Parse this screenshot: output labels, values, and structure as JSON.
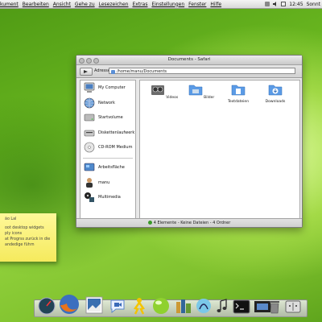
{
  "menubar": {
    "items": [
      "kument",
      "Bearbeiten",
      "Ansicht",
      "Gehe zu",
      "Lesezeichen",
      "Extras",
      "Einstellungen",
      "Fenster",
      "Hilfe"
    ],
    "clock": "12:45",
    "day": "Sonnt"
  },
  "window": {
    "title": "Documents - Safari",
    "address_label": "Adresse:",
    "address_value": "/home/manu/Documents",
    "status": "4 Elemente - Keine Dateien - 4 Ordner"
  },
  "sidebar": {
    "devices": [
      {
        "label": "My Computer",
        "icon": "computer-icon"
      },
      {
        "label": "Network",
        "icon": "network-icon"
      },
      {
        "label": "Startvolume",
        "icon": "hard-drive-icon"
      },
      {
        "label": "Diskettenlaufwerk",
        "icon": "floppy-drive-icon"
      },
      {
        "label": "CD-ROM Medium",
        "icon": "cdrom-icon"
      }
    ],
    "places": [
      {
        "label": "Arbeitsfläche",
        "icon": "desktop-icon"
      },
      {
        "label": "manu",
        "icon": "home-user-icon"
      },
      {
        "label": "Multimedia",
        "icon": "multimedia-icon"
      }
    ]
  },
  "files": [
    {
      "label": "Videos",
      "icon": "video-folder-icon"
    },
    {
      "label": "Bilder",
      "icon": "pictures-folder-icon"
    },
    {
      "label": "Textdateien",
      "icon": "text-folder-icon"
    },
    {
      "label": "Downloads",
      "icon": "downloads-folder-icon"
    }
  ],
  "note": {
    "title": "ão Lal",
    "lines": [
      "oot desktop widgets",
      "ply icons",
      "at Progrss zurück in die",
      "andedige führn"
    ]
  },
  "dock": [
    "dashboard-icon",
    "firefox-icon",
    "preview-icon",
    "ichat-icon",
    "aim-icon",
    "green-sphere-icon",
    "books-icon",
    "amarok-icon",
    "terminal-icon",
    "film-icon",
    "trash-icon",
    "finder-icon"
  ],
  "colors": {
    "accent": "#7fc12d",
    "note": "#f7ec63",
    "folder": "#5b9be6"
  }
}
